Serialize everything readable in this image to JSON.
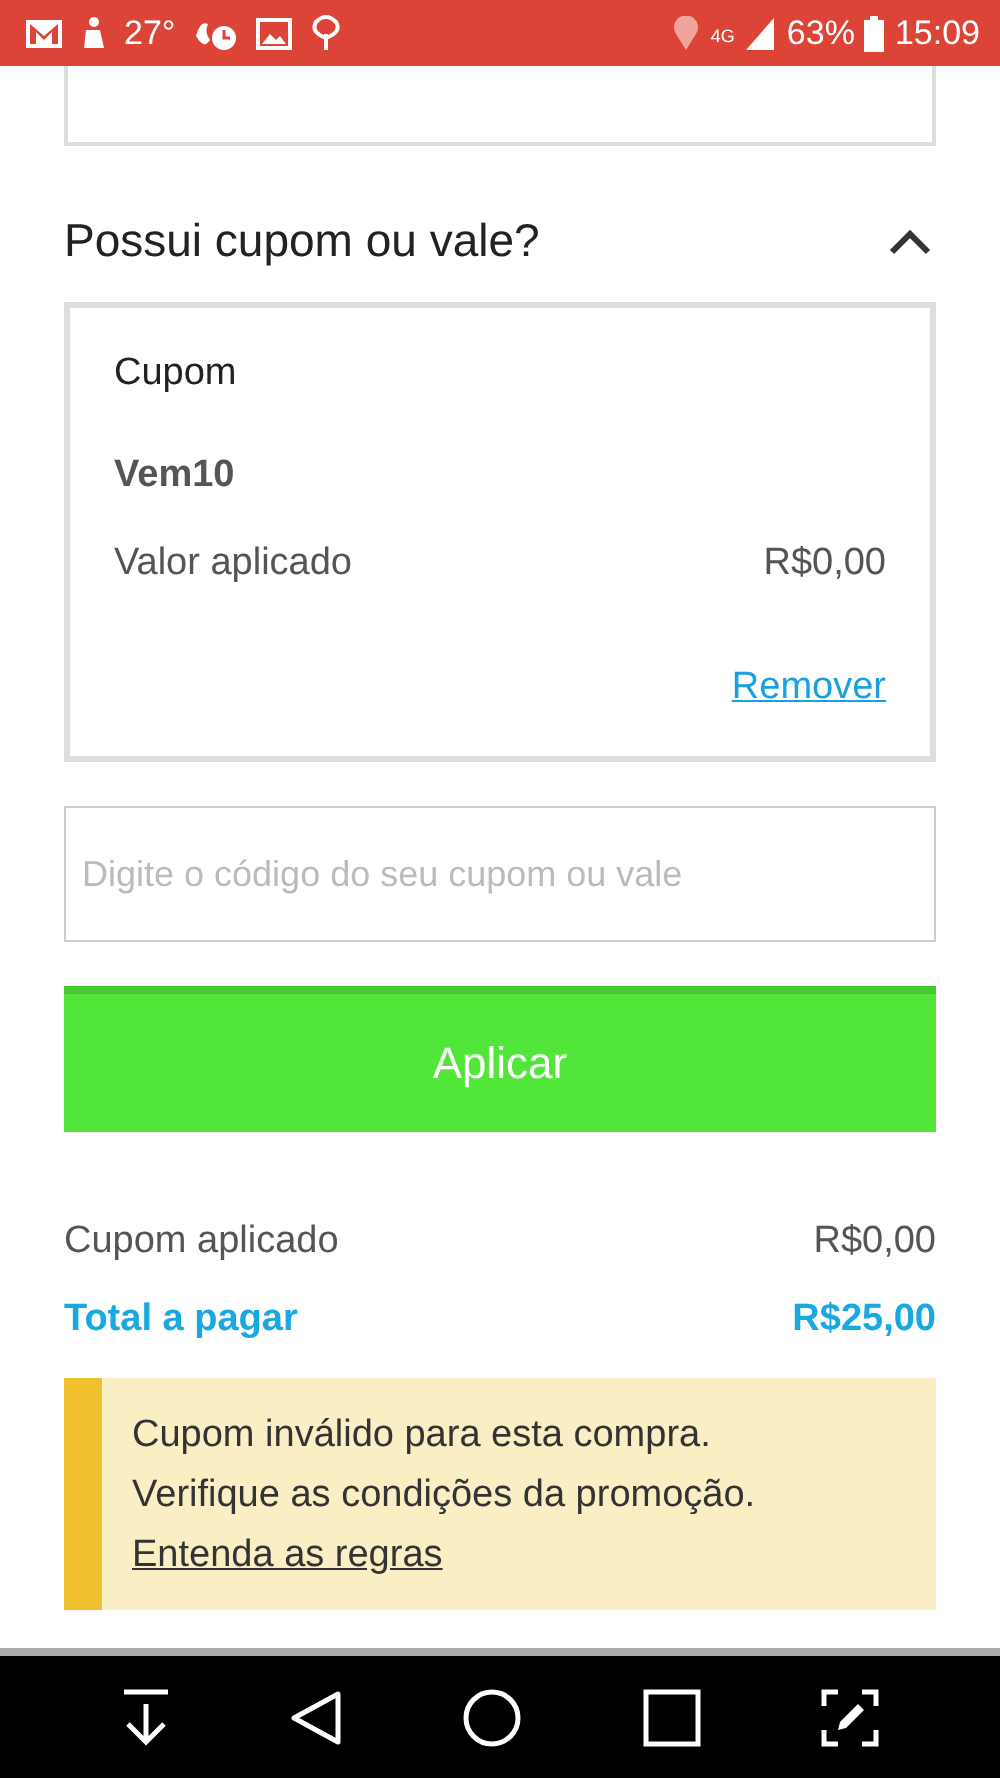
{
  "status_bar": {
    "temperature": "27°",
    "network": "4G",
    "battery": "63%",
    "time": "15:09"
  },
  "coupon_section": {
    "title": "Possui cupom ou vale?",
    "expanded": true,
    "applied_coupon": {
      "heading": "Cupom",
      "code": "Vem10",
      "value_label": "Valor aplicado",
      "value": "R$0,00",
      "remove_link": "Remover"
    },
    "input": {
      "placeholder": "Digite o código do seu cupom ou vale"
    },
    "apply_button": "Aplicar"
  },
  "summary": [
    {
      "label": "Cupom aplicado",
      "value": "R$0,00",
      "kind": "normal"
    },
    {
      "label": "Total a pagar",
      "value": "R$25,00",
      "kind": "total"
    }
  ],
  "warning": {
    "lines": [
      "Cupom inválido para esta compra.",
      "Verifique as condições da promoção."
    ],
    "link": "Entenda as regras"
  }
}
